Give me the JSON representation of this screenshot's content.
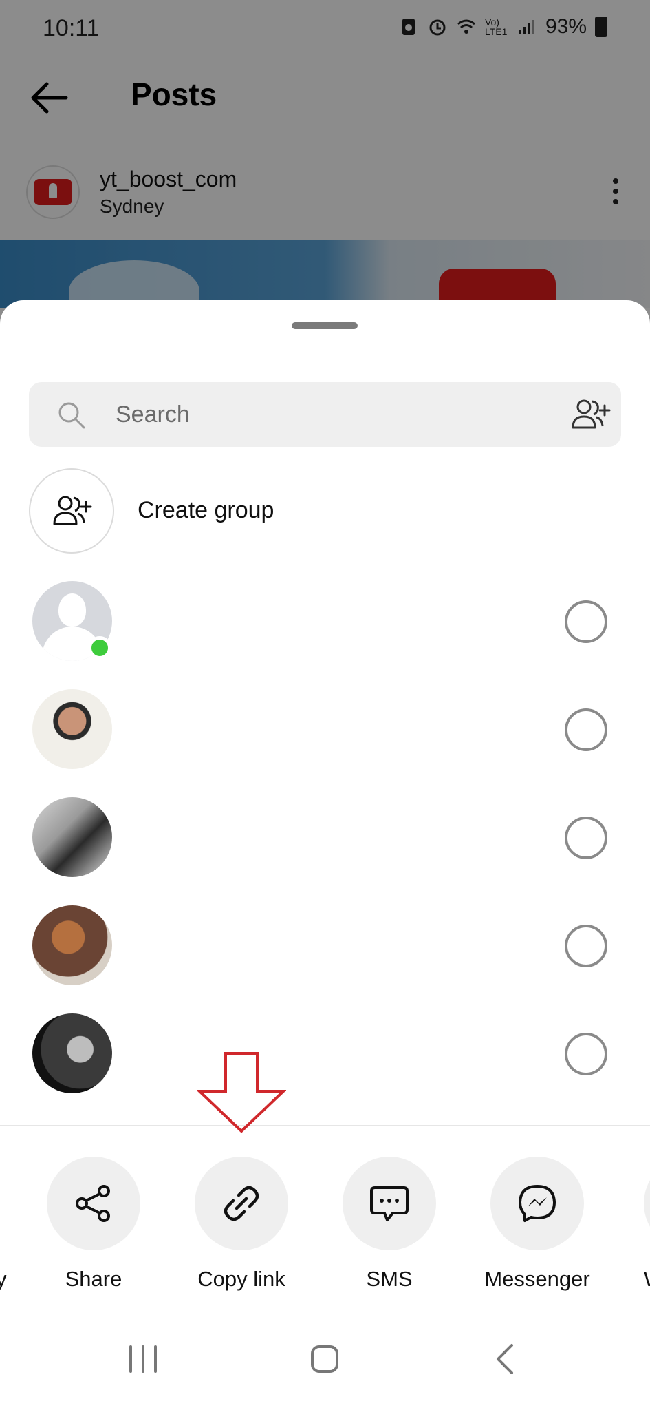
{
  "status_bar": {
    "time": "10:11",
    "battery": "93%",
    "network_label": "Vo) LTE1"
  },
  "header": {
    "title": "Posts"
  },
  "post": {
    "author_name": "yt_boost_com",
    "author_location": "Sydney"
  },
  "share_sheet": {
    "search": {
      "placeholder": "Search",
      "value": ""
    },
    "create_group_label": "Create group",
    "contacts": [
      {
        "name": "",
        "avatar": "default-avatar",
        "online": true,
        "selected": false
      },
      {
        "name": "",
        "avatar": "photo-avatar",
        "online": false,
        "selected": false
      },
      {
        "name": "",
        "avatar": "photo-avatar",
        "online": false,
        "selected": false
      },
      {
        "name": "",
        "avatar": "photo-avatar",
        "online": false,
        "selected": false
      },
      {
        "name": "",
        "avatar": "photo-avatar",
        "online": false,
        "selected": false
      }
    ],
    "share_options": [
      {
        "label": "Share",
        "icon": "share-nodes-icon"
      },
      {
        "label": "Copy link",
        "icon": "link-icon"
      },
      {
        "label": "SMS",
        "icon": "sms-icon"
      },
      {
        "label": "Messenger",
        "icon": "messenger-icon"
      }
    ],
    "edge_left_label": "y",
    "edge_right_label": "W"
  },
  "colors": {
    "online": "#3ecc3c",
    "annotation_arrow": "#d0282c",
    "sheet_bg": "#ffffff",
    "chip_bg": "#efefef"
  }
}
